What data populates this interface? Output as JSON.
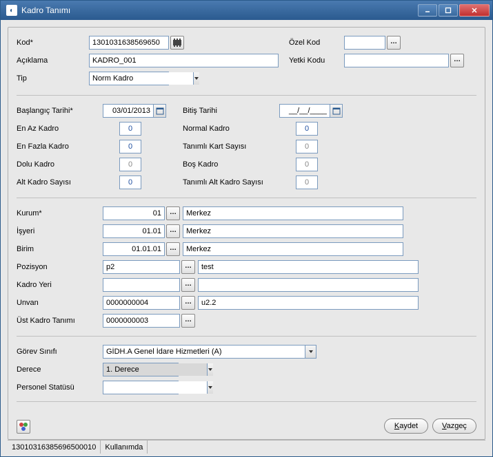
{
  "window": {
    "title": "Kadro Tanımı"
  },
  "section1": {
    "kod_label": "Kod*",
    "kod_value": "1301031638569650",
    "aciklama_label": "Açıklama",
    "aciklama_value": "KADRO_001",
    "tip_label": "Tip",
    "tip_value": "Norm Kadro",
    "ozel_kod_label": "Özel Kod",
    "ozel_kod_value": "",
    "yetki_kodu_label": "Yetki Kodu",
    "yetki_kodu_value": ""
  },
  "section2": {
    "baslangic_label": "Başlangıç Tarihi*",
    "baslangic_value": "03/01/2013",
    "bitis_label": "Bitiş Tarihi",
    "bitis_value": "__/__/____",
    "en_az_label": "En Az Kadro",
    "en_az_value": "0",
    "normal_label": "Normal Kadro",
    "normal_value": "0",
    "en_fazla_label": "En Fazla Kadro",
    "en_fazla_value": "0",
    "tanimli_kart_label": "Tanımlı Kart Sayısı",
    "tanimli_kart_value": "0",
    "dolu_label": "Dolu Kadro",
    "dolu_value": "0",
    "bos_label": "Boş Kadro",
    "bos_value": "0",
    "alt_label": "Alt Kadro Sayısı",
    "alt_value": "0",
    "tanimli_alt_label": "Tanımlı Alt Kadro Sayısı",
    "tanimli_alt_value": "0"
  },
  "section3": {
    "kurum_label": "Kurum*",
    "kurum_code": "01",
    "kurum_desc": "Merkez",
    "isyeri_label": "İşyeri",
    "isyeri_code": "01.01",
    "isyeri_desc": "Merkez",
    "birim_label": "Birim",
    "birim_code": "01.01.01",
    "birim_desc": "Merkez",
    "pozisyon_label": "Pozisyon",
    "pozisyon_code": "p2",
    "pozisyon_desc": "test",
    "kadroyeri_label": "Kadro Yeri",
    "kadroyeri_code": "",
    "kadroyeri_desc": "",
    "unvan_label": "Unvan",
    "unvan_code": "0000000004",
    "unvan_desc": "u2.2",
    "ust_label": "Üst Kadro Tanımı",
    "ust_code": "0000000003"
  },
  "section4": {
    "gorev_label": "Görev Sınıfı",
    "gorev_value": "GİDH.A Genel İdare Hizmetleri (A)",
    "derece_label": "Derece",
    "derece_value": "1. Derece",
    "statu_label": "Personel Statüsü",
    "statu_value": ""
  },
  "buttons": {
    "save": "aydet",
    "save_accel": "K",
    "cancel": "azgeç",
    "cancel_accel": "V"
  },
  "status": {
    "id": "13010316385696500010",
    "state": "Kullanımda"
  }
}
